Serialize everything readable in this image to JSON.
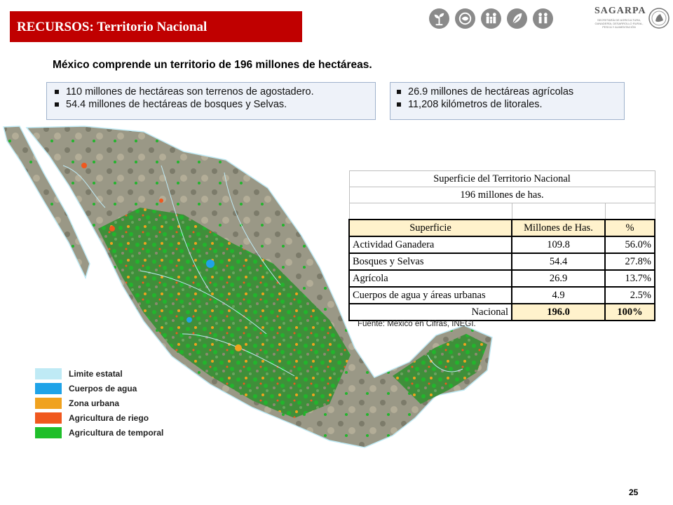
{
  "header": {
    "title": "RECURSOS: Territorio Nacional",
    "accent_color": "#c00000",
    "icons": [
      "plant-icon",
      "fish-icon",
      "family-icon",
      "leaf-icon",
      "people-icon"
    ]
  },
  "logo": {
    "name": "SAGARPA",
    "subtitle": "SECRETARÍA DE AGRICULTURA, GANADERÍA, DESARROLLO RURAL, PESCA Y ALIMENTACIÓN"
  },
  "headline": "México comprende un territorio de 196 millones de hectáreas.",
  "bullets_left": [
    "110 millones de hectáreas son terrenos de agostadero.",
    "54.4 millones de hectáreas de bosques y Selvas."
  ],
  "bullets_right": [
    "26.9 millones de hectáreas agrícolas",
    "11,208 kilómetros de litorales."
  ],
  "table": {
    "title1": "Superficie del Territorio Nacional",
    "title2": "196 millones de has.",
    "headers": [
      "Superficie",
      "Millones de Has.",
      "%"
    ],
    "rows": [
      [
        "Actividad Ganadera",
        "109.8",
        "56.0%"
      ],
      [
        "Bosques y Selvas",
        "54.4",
        "27.8%"
      ],
      [
        "Agrícola",
        "26.9",
        "13.7%"
      ],
      [
        "Cuerpos de agua y áreas urbanas",
        "4.9",
        "2.5%"
      ]
    ],
    "total": [
      "Nacional",
      "196.0",
      "100%"
    ]
  },
  "source": "Fuente: México en Cifras, INEGI.",
  "legend": [
    {
      "label": "Limite estatal",
      "color": "#bfeaf5"
    },
    {
      "label": "Cuerpos de agua",
      "color": "#1fa3e8"
    },
    {
      "label": "Zona urbana",
      "color": "#f0a21e"
    },
    {
      "label": "Agricultura de riego",
      "color": "#f0581e"
    },
    {
      "label": "Agricultura de temporal",
      "color": "#1fbf2a"
    }
  ],
  "page_number": "25"
}
